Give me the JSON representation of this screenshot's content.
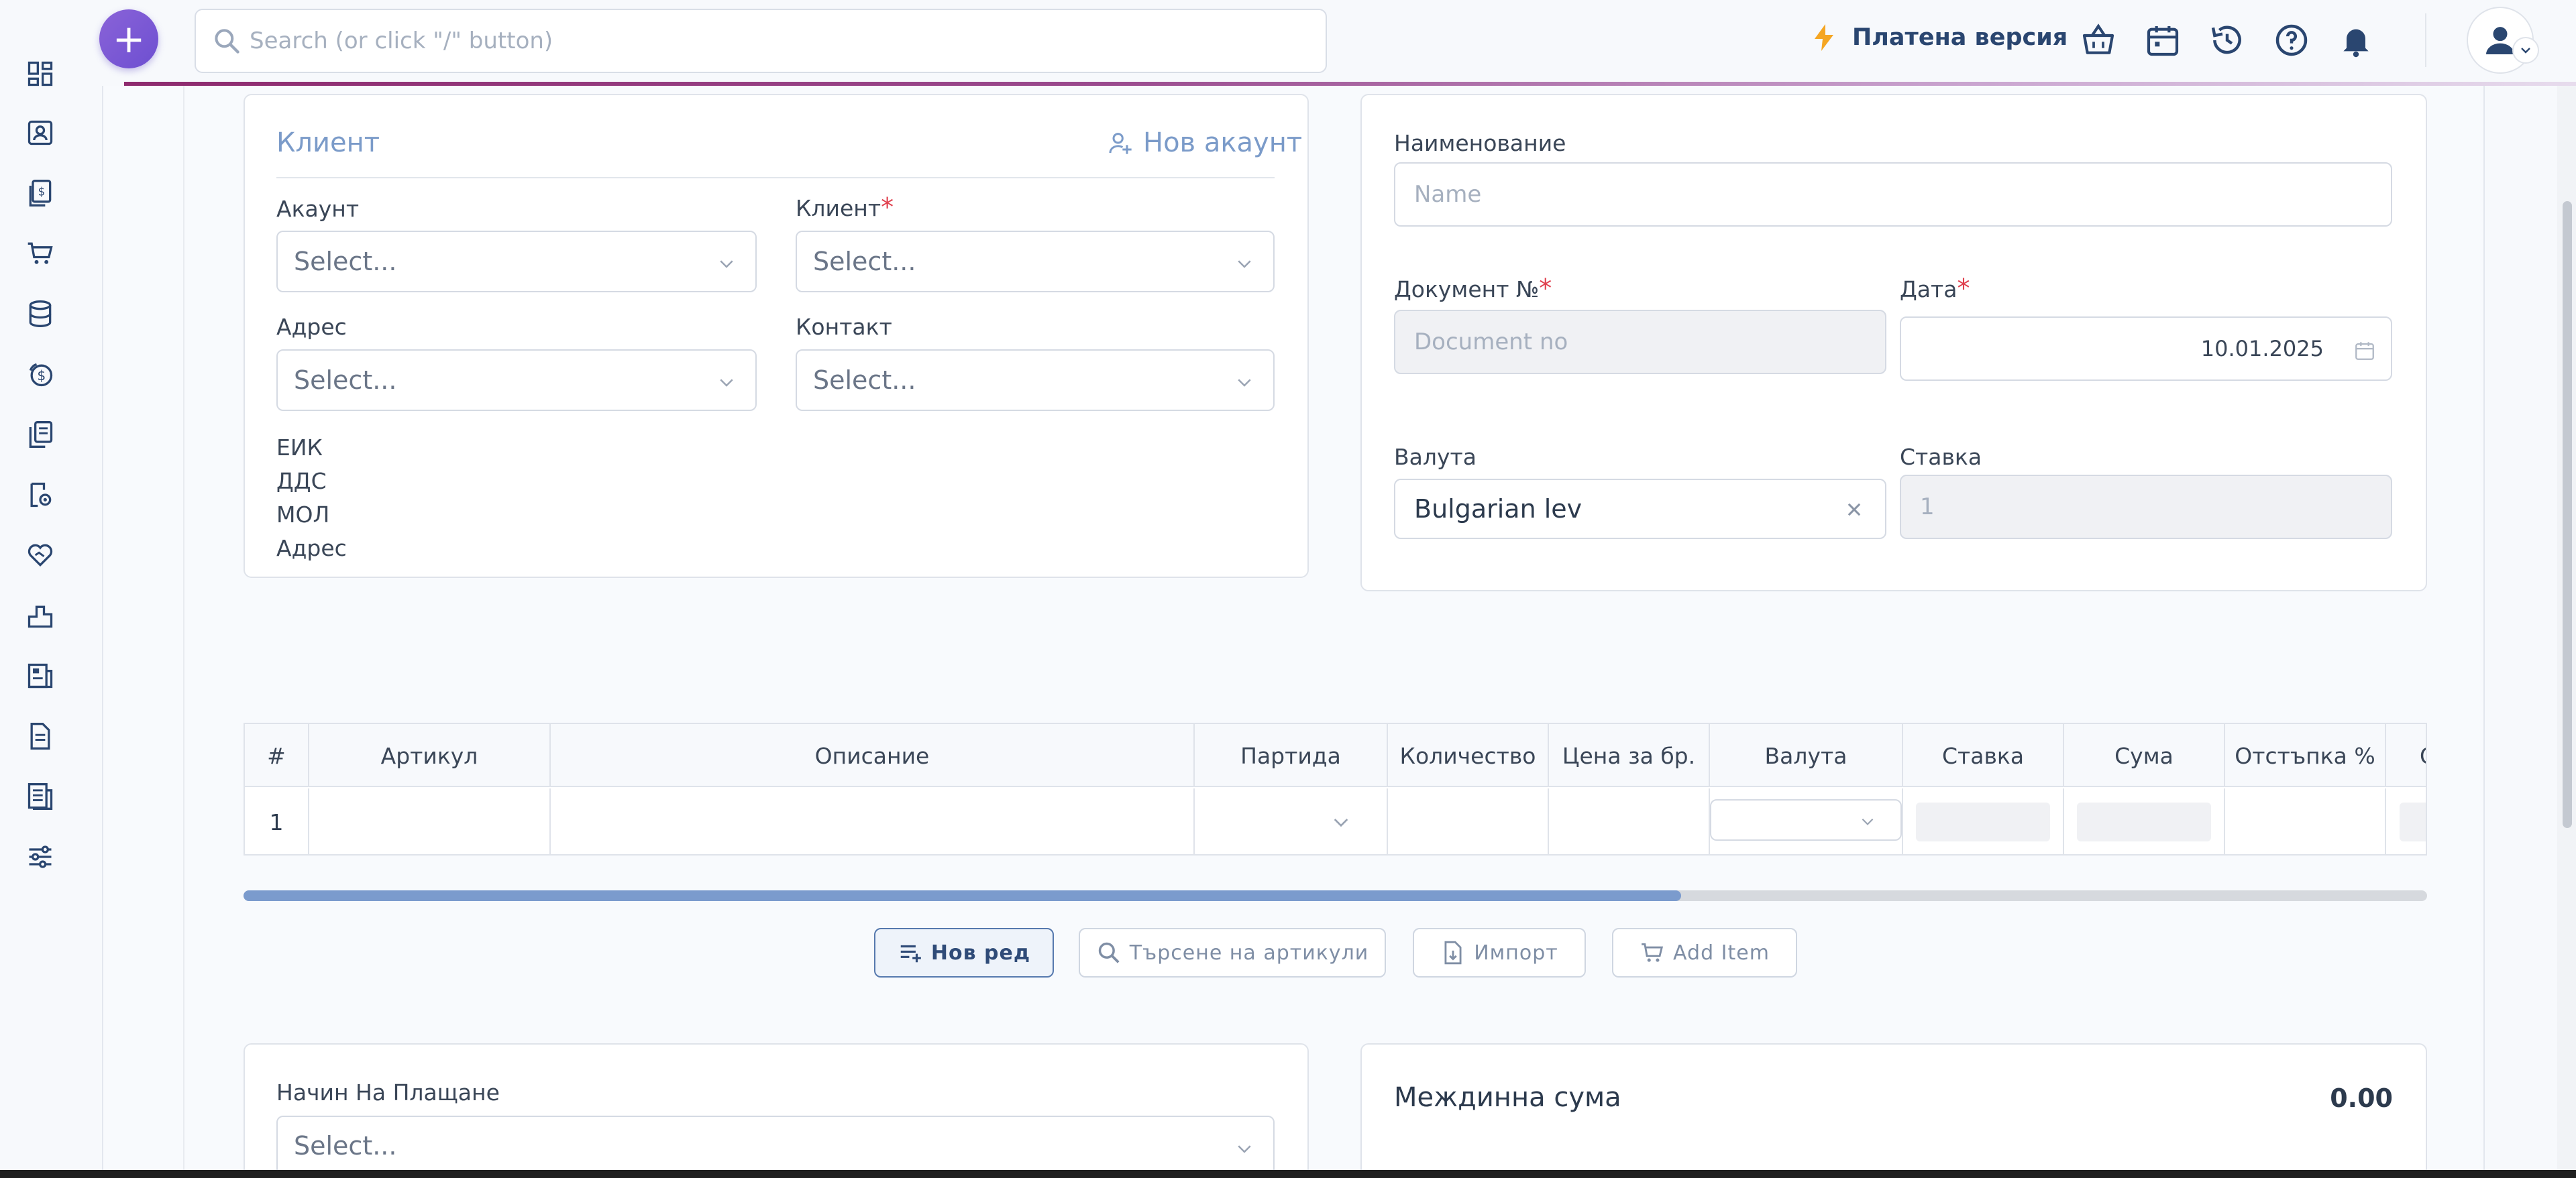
{
  "topbar": {
    "search_placeholder": "Search (or click \"/\" button)",
    "paid_version": "Платена версия",
    "icons": [
      "basket-icon",
      "calendar-icon",
      "history-icon",
      "help-icon",
      "bell-icon"
    ]
  },
  "sidebar": {
    "icons": [
      "dashboard-icon",
      "contacts-icon",
      "invoices-icon",
      "cart-icon",
      "database-icon",
      "coins-icon",
      "documents-icon",
      "settings-doc-icon",
      "handshake-icon",
      "chart-icon",
      "report-icon",
      "file-icon",
      "reports-icon",
      "sliders-icon"
    ]
  },
  "client_card": {
    "title": "Клиент",
    "new_account": "Нов акаунт",
    "account_label": "Акаунт",
    "account_value": "Select...",
    "client_label": "Клиент",
    "client_value": "Select...",
    "address_label": "Адрес",
    "address_value": "Select...",
    "contact_label": "Контакт",
    "contact_value": "Select...",
    "info": [
      "ЕИК",
      "ДДС",
      "МОЛ",
      "Адрес"
    ]
  },
  "doc_card": {
    "name_label": "Наименование",
    "name_placeholder": "Name",
    "docno_label": "Документ №",
    "docno_placeholder": "Document no",
    "date_label": "Дата",
    "date_value": "10.01.2025",
    "currency_label": "Валута",
    "currency_value": "Bulgarian lev",
    "rate_label": "Ставка",
    "rate_value": "1"
  },
  "table": {
    "headers": [
      "#",
      "Артикул",
      "Описание",
      "Партида",
      "Количество",
      "Цена за бр.",
      "Валута",
      "Ставка",
      "Сума",
      "Отстъпка %",
      "С"
    ],
    "row_number": "1"
  },
  "actions": {
    "new_row": "Нов ред",
    "search_items": "Търсене на артикули",
    "import": "Импорт",
    "add_item": "Add Item"
  },
  "payment": {
    "method_label": "Начин На Плащане",
    "method_value": "Select..."
  },
  "totals": {
    "subtotal_label": "Междинна сума",
    "subtotal_value": "0.00"
  }
}
